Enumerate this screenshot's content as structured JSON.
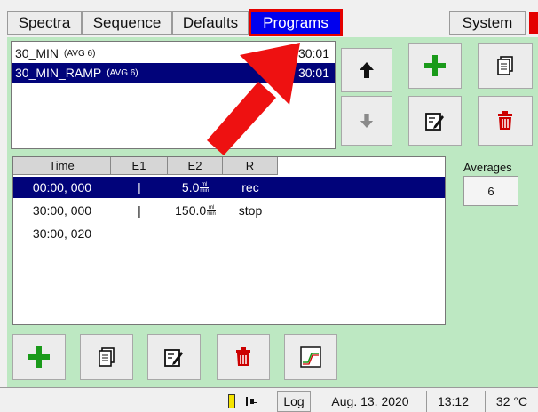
{
  "tabs": [
    {
      "label": "Spectra"
    },
    {
      "label": "Sequence"
    },
    {
      "label": "Defaults"
    },
    {
      "label": "Programs"
    },
    {
      "label": "System"
    }
  ],
  "programs": [
    {
      "name": "30_MIN",
      "avg": "(AVG 6)",
      "duration": "30:01",
      "selected": false
    },
    {
      "name": "30_MIN_RAMP",
      "avg": "(AVG 6)",
      "duration": "30:01",
      "selected": true
    }
  ],
  "table": {
    "headers": [
      "Time",
      "E1",
      "E2",
      "R"
    ],
    "rows": [
      {
        "time": "00:00, 000",
        "e1": "|",
        "e2": "5.0",
        "r": "rec",
        "selected": true
      },
      {
        "time": "30:00, 000",
        "e1": "|",
        "e2": "150.0",
        "r": "stop",
        "selected": false
      },
      {
        "time": "30:00, 020",
        "e1": "",
        "e2": "",
        "r": "",
        "selected": false
      }
    ],
    "unit_top": "ml",
    "unit_bottom": "min"
  },
  "averages": {
    "label": "Averages",
    "value": "6"
  },
  "status": {
    "log": "Log",
    "date": "Aug. 13. 2020",
    "time": "13:12",
    "temperature": "32 °C"
  },
  "colors": {
    "accent_blue": "#0000ee",
    "selection_navy": "#01037a",
    "highlight_red": "#e40000",
    "panel_green": "#bde8c2",
    "add_green": "#1a9a1a",
    "delete_red": "#cc0000"
  },
  "icons": {
    "move_up": "arrow-up-icon",
    "move_down": "arrow-down-icon",
    "add": "plus-icon",
    "copy": "copy-icon",
    "edit": "edit-icon",
    "delete": "trash-icon",
    "chart": "chart-icon",
    "power": "plug-icon",
    "battery": "battery-icon"
  }
}
